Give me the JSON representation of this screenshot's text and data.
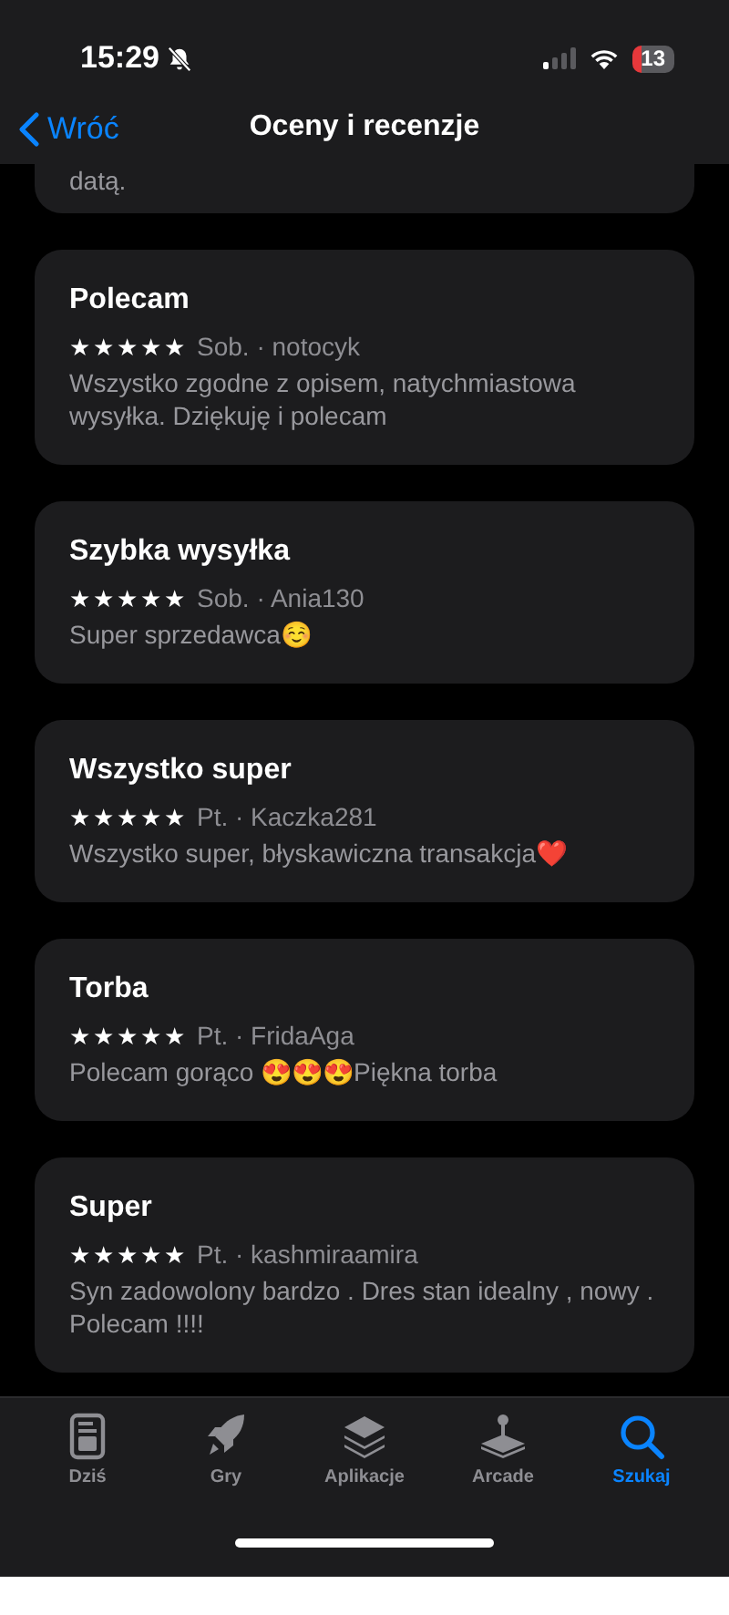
{
  "status_bar": {
    "time": "15:29",
    "battery": "13"
  },
  "nav": {
    "back": "Wróć",
    "title": "Oceny i recenzje"
  },
  "partial_review": {
    "body": "datą."
  },
  "reviews": [
    {
      "title": "Polecam",
      "stars": 5,
      "meta": "Sob. · notocyk",
      "body": "Wszystko zgodne z opisem, natychmiastowa wysyłka. Dziękuję i polecam"
    },
    {
      "title": "Szybka wysyłka",
      "stars": 5,
      "meta": "Sob. · Ania130",
      "body": "Super sprzedawca☺️"
    },
    {
      "title": "Wszystko super",
      "stars": 5,
      "meta": "Pt. · Kaczka281",
      "body": "Wszystko super, błyskawiczna transakcja❤️"
    },
    {
      "title": "Torba",
      "stars": 5,
      "meta": "Pt. · FridaAga",
      "body": "Polecam gorąco 😍😍😍Piękna torba"
    },
    {
      "title": "Super",
      "stars": 5,
      "meta": "Pt. · kashmiraamira",
      "body": "Syn zadowolony bardzo . Dres stan idealny , nowy . Polecam !!!!"
    }
  ],
  "tab_bar": [
    {
      "kind": "today",
      "label": "Dziś",
      "selected": false
    },
    {
      "kind": "games",
      "label": "Gry",
      "selected": false
    },
    {
      "kind": "apps",
      "label": "Aplikacje",
      "selected": false
    },
    {
      "kind": "arcade",
      "label": "Arcade",
      "selected": false
    },
    {
      "kind": "search",
      "label": "Szukaj",
      "selected": true
    }
  ]
}
